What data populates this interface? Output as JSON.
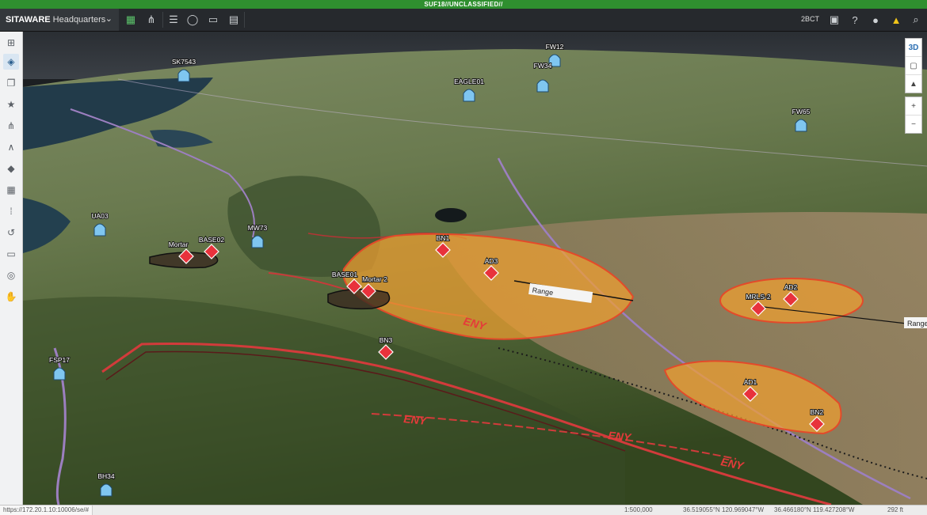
{
  "classification": "SUF18//UNCLASSIFIED//",
  "app": {
    "brand": "SITAWARE",
    "context": "Headquarters"
  },
  "toolbar": {
    "unit": "2BCT"
  },
  "map": {
    "units_friendly": [
      {
        "id": "sk7543",
        "label": "SK7543"
      },
      {
        "id": "fw12",
        "label": "FW12"
      },
      {
        "id": "eagle01",
        "label": "EAGLE01"
      },
      {
        "id": "fw34",
        "label": "FW34"
      },
      {
        "id": "fw65",
        "label": "FW65"
      },
      {
        "id": "ua03",
        "label": "UA03"
      },
      {
        "id": "mw73",
        "label": "MW73"
      },
      {
        "id": "fsp",
        "label": "FSP17"
      },
      {
        "id": "bh34",
        "label": "BH34"
      }
    ],
    "units_hostile": [
      {
        "id": "bn1",
        "label": "BN1"
      },
      {
        "id": "ad3",
        "label": "AD3"
      },
      {
        "id": "base02",
        "label": "BASE02"
      },
      {
        "id": "mortar",
        "label": "Mortar"
      },
      {
        "id": "base01",
        "label": "BASE01"
      },
      {
        "id": "mortar2",
        "label": "Mortar 2"
      },
      {
        "id": "bn3",
        "label": "BN3"
      },
      {
        "id": "ad2",
        "label": "AD2"
      },
      {
        "id": "mrls2",
        "label": "MRLS-2"
      },
      {
        "id": "ad1",
        "label": "AD1"
      },
      {
        "id": "bn2",
        "label": "BN2"
      }
    ],
    "enemy_label": "ENY",
    "range_label": "Range",
    "colors": {
      "threat_fill": "#f0a030",
      "threat_stroke": "#e34a2a",
      "hostile": "#e8323c",
      "friendly": "#7fc6f0",
      "boundary": "#d23b3b"
    }
  },
  "map_controls": {
    "mode_3d": "3D",
    "zoom_in": "+",
    "zoom_out": "−"
  },
  "status": {
    "url": "https://172.20.1.10:10006/se/#",
    "scale": "1:500,000",
    "coord1": "36.519055°N 120.969047°W",
    "coord2": "36.466180°N 119.427208°W",
    "altitude": "292 ft"
  }
}
